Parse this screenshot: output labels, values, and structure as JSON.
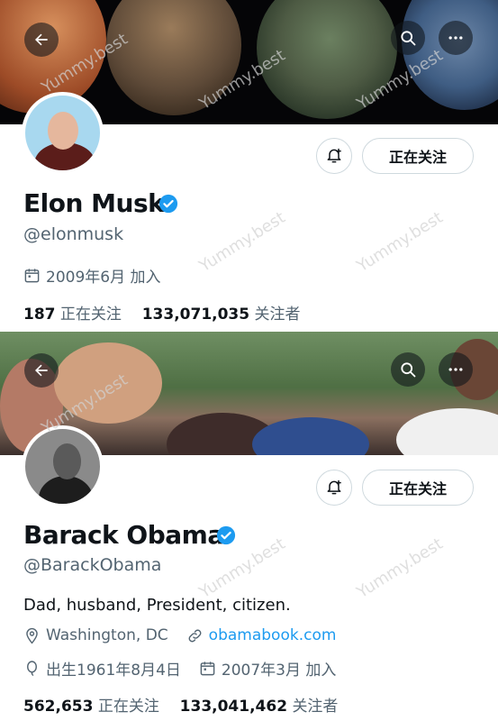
{
  "icons": {
    "back": "arrow-left-icon",
    "search": "search-icon",
    "more": "more-icon",
    "bell": "notification-bell-icon",
    "verified": "verified-badge-icon",
    "calendar": "calendar-icon",
    "location": "location-icon",
    "link": "link-icon",
    "birthday": "balloon-icon"
  },
  "colors": {
    "verified": "#1d9bf0",
    "link": "#1d9bf0",
    "muted": "#536471",
    "text": "#0f1419"
  },
  "watermark": "Yummy.best",
  "profiles": [
    {
      "name": "Elon Musk",
      "handle": "@elonmusk",
      "follow_label": "正在关注",
      "joined": "2009年6月 加入",
      "following_count": "187",
      "following_label": "正在关注",
      "followers_count": "133,071,035",
      "followers_label": "关注者"
    },
    {
      "name": "Barack Obama",
      "handle": "@BarackObama",
      "follow_label": "正在关注",
      "bio": "Dad, husband, President, citizen.",
      "location": "Washington, DC",
      "website": "obamabook.com",
      "birthday": "出生1961年8月4日",
      "joined": "2007年3月 加入",
      "following_count": "562,653",
      "following_label": "正在关注",
      "followers_count": "133,041,462",
      "followers_label": "关注者"
    }
  ]
}
